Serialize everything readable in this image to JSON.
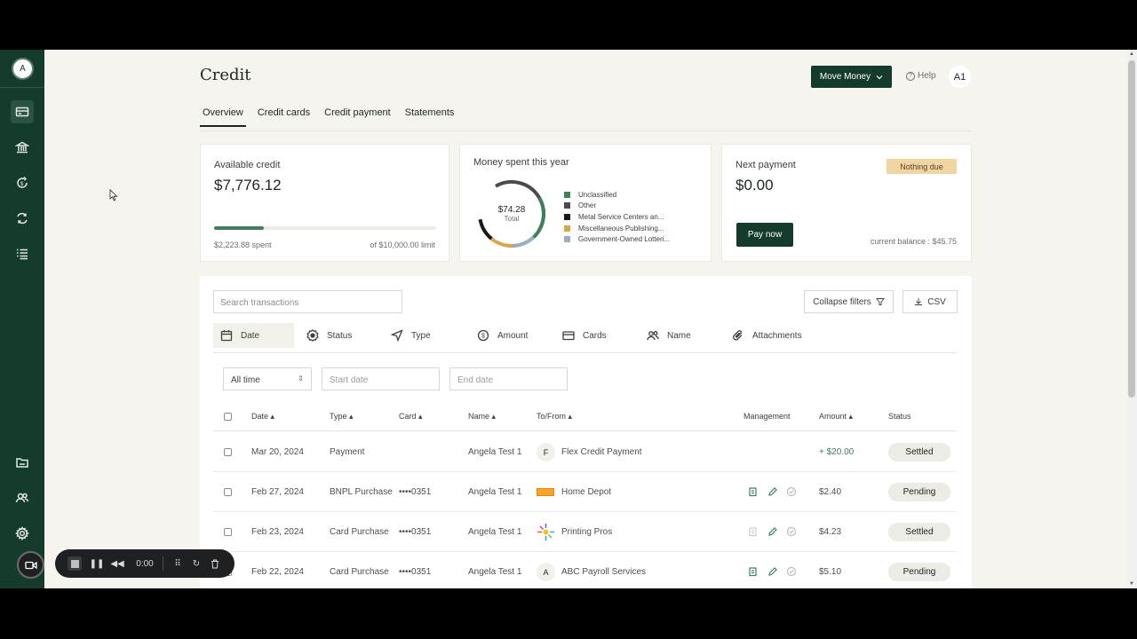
{
  "sidebar": {
    "avatar_initial": "A",
    "icons": [
      "credit-card-icon",
      "bank-icon",
      "money-cycle-icon",
      "transfer-icon",
      "list-icon",
      "folder-icon",
      "users-icon",
      "gear-icon"
    ]
  },
  "header": {
    "title": "Credit",
    "move_money_label": "Move Money",
    "help_label": "Help",
    "user_initials": "A1"
  },
  "tabs": [
    {
      "label": "Overview",
      "active": true
    },
    {
      "label": "Credit cards",
      "active": false
    },
    {
      "label": "Credit payment",
      "active": false
    },
    {
      "label": "Statements",
      "active": false
    }
  ],
  "available_credit": {
    "label": "Available credit",
    "amount": "$7,776.12",
    "spent": "$2,223.88 spent",
    "limit": "of $10,000.00 limit",
    "spent_fraction": 0.2224
  },
  "money_spent": {
    "label": "Money spent this year",
    "total_value": "$74.28",
    "total_label": "Total",
    "legend": [
      {
        "label": "Unclassified",
        "color": "#3f7f59"
      },
      {
        "label": "Other",
        "color": "#4a4a4a"
      },
      {
        "label": "Metal Service Centers an...",
        "color": "#1a1a1a"
      },
      {
        "label": "Miscellaneous Publishing...",
        "color": "#d9a84e"
      },
      {
        "label": "Government-Owned Lotteri...",
        "color": "#9ab0c2"
      }
    ]
  },
  "next_payment": {
    "label": "Next payment",
    "amount": "$0.00",
    "badge": "Nothing due",
    "pay_label": "Pay now",
    "current_balance": "current balance : $45.75"
  },
  "transactions": {
    "search_placeholder": "Search transactions",
    "collapse_filters_label": "Collapse filters",
    "csv_label": "CSV",
    "filters": [
      "Date",
      "Status",
      "Type",
      "Amount",
      "Cards",
      "Name",
      "Attachments"
    ],
    "time_select": "All time",
    "start_date_placeholder": "Start date",
    "end_date_placeholder": "End date",
    "columns": [
      "Date",
      "Type",
      "Card",
      "Name",
      "To/From",
      "Management",
      "Amount",
      "Status"
    ],
    "rows": [
      {
        "date": "Mar 20, 2024",
        "type": "Payment",
        "card": "",
        "name": "Angela Test 1",
        "to_from": "Flex Credit Payment",
        "logo": "F",
        "amount": "+ $20.00",
        "status": "Settled"
      },
      {
        "date": "Feb 27, 2024",
        "type": "BNPL Purchase",
        "card": "••••0351",
        "name": "Angela Test 1",
        "to_from": "Home Depot",
        "logo": "",
        "amount": "$2.40",
        "status": "Pending"
      },
      {
        "date": "Feb 23, 2024",
        "type": "Card Purchase",
        "card": "••••0351",
        "name": "Angela Test 1",
        "to_from": "Printing Pros",
        "logo": "",
        "amount": "$4.23",
        "status": "Settled"
      },
      {
        "date": "Feb 22, 2024",
        "type": "Card Purchase",
        "card": "••••0351",
        "name": "Angela Test 1",
        "to_from": "ABC Payroll Services",
        "logo": "A",
        "amount": "$5.10",
        "status": "Pending"
      }
    ]
  },
  "recorder": {
    "time": "0:00"
  }
}
